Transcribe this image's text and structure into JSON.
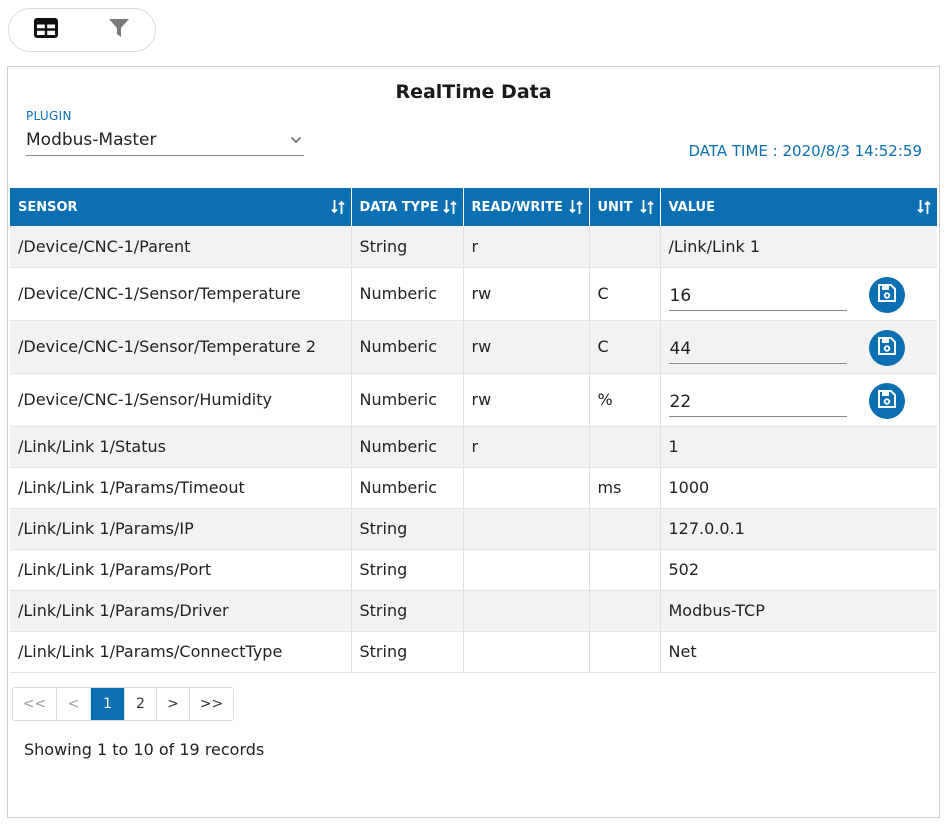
{
  "toolbar": {
    "items": [
      {
        "icon": "table-icon"
      },
      {
        "icon": "filter-icon"
      }
    ]
  },
  "panel": {
    "title": "RealTime Data",
    "plugin_label": "PLUGIN",
    "plugin_value": "Modbus-Master",
    "data_time": "DATA TIME : 2020/8/3 14:52:59"
  },
  "table": {
    "columns": [
      "SENSOR",
      "DATA TYPE",
      "READ/WRITE",
      "UNIT",
      "VALUE"
    ],
    "rows": [
      {
        "sensor": "/Device/CNC-1/Parent",
        "type": "String",
        "rw": "r",
        "unit": "",
        "value": "/Link/Link 1"
      },
      {
        "sensor": "/Device/CNC-1/Sensor/Temperature",
        "type": "Numberic",
        "rw": "rw",
        "unit": "C",
        "value": "16"
      },
      {
        "sensor": "/Device/CNC-1/Sensor/Temperature 2",
        "type": "Numberic",
        "rw": "rw",
        "unit": "C",
        "value": "44"
      },
      {
        "sensor": "/Device/CNC-1/Sensor/Humidity",
        "type": "Numberic",
        "rw": "rw",
        "unit": "%",
        "value": "22"
      },
      {
        "sensor": "/Link/Link 1/Status",
        "type": "Numberic",
        "rw": "r",
        "unit": "",
        "value": "1"
      },
      {
        "sensor": "/Link/Link 1/Params/Timeout",
        "type": "Numberic",
        "rw": "",
        "unit": "ms",
        "value": "1000"
      },
      {
        "sensor": "/Link/Link 1/Params/IP",
        "type": "String",
        "rw": "",
        "unit": "",
        "value": "127.0.0.1"
      },
      {
        "sensor": "/Link/Link 1/Params/Port",
        "type": "String",
        "rw": "",
        "unit": "",
        "value": "502"
      },
      {
        "sensor": "/Link/Link 1/Params/Driver",
        "type": "String",
        "rw": "",
        "unit": "",
        "value": "Modbus-TCP"
      },
      {
        "sensor": "/Link/Link 1/Params/ConnectType",
        "type": "String",
        "rw": "",
        "unit": "",
        "value": "Net"
      }
    ]
  },
  "pagination": {
    "first": "<<",
    "prev": "<",
    "pages": [
      "1",
      "2"
    ],
    "current_page": "1",
    "next": ">",
    "last": ">>"
  },
  "records_text": "Showing 1 to 10 of 19 records",
  "colors": {
    "accent": "#0b70b3",
    "row_alt": "#f2f2f2"
  }
}
